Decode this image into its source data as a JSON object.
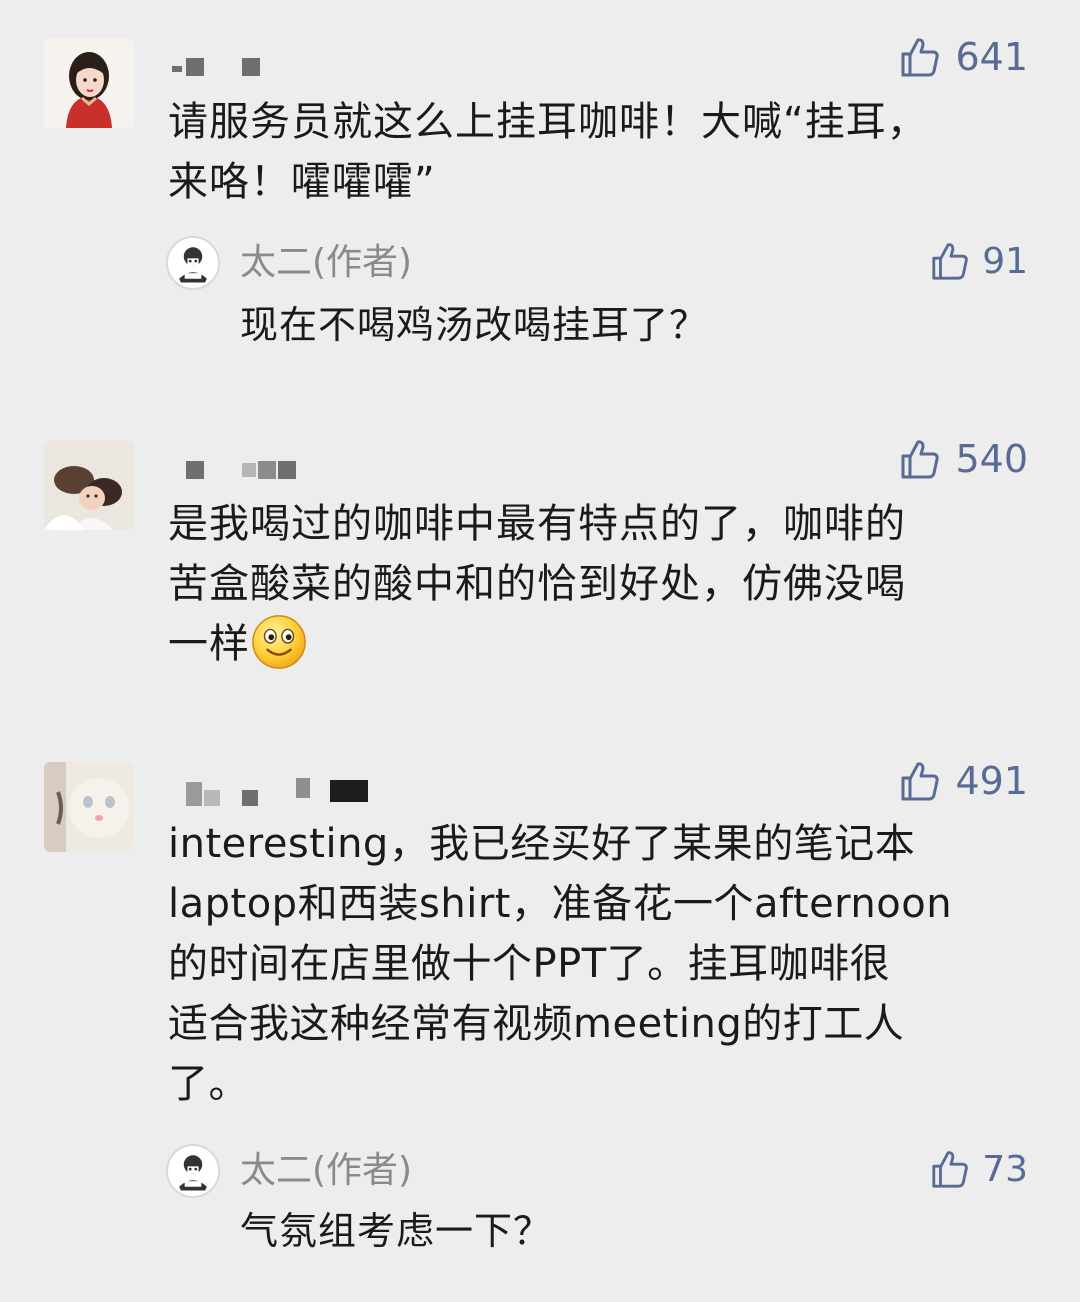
{
  "comments": [
    {
      "likes": "641",
      "text": "请服务员就这么上挂耳咖啡！大喊“挂耳，\n来咯！嚯嚯嚯”",
      "reply": {
        "name": "太二(作者)",
        "likes": "91",
        "text": "现在不喝鸡汤改喝挂耳了？"
      }
    },
    {
      "likes": "540",
      "text_before_emoji": "是我喝过的咖啡中最有特点的了，咖啡的\n苦盒酸菜的酸中和的恰到好处，仿佛没喝\n一样",
      "emoji": "smile-emoji"
    },
    {
      "likes": "491",
      "text": "interesting，我已经买好了某果的笔记本\nlaptop和西装shirt，准备花一个afternoon\n的时间在店里做十个PPT了。挂耳咖啡很\n适合我这种经常有视频meeting的打工人\n了。",
      "reply": {
        "name": "太二(作者)",
        "likes": "73",
        "text": "气氛组考虑一下？"
      }
    }
  ],
  "icons": {
    "like": "thumbs-up-icon",
    "accent": "#576b95"
  }
}
